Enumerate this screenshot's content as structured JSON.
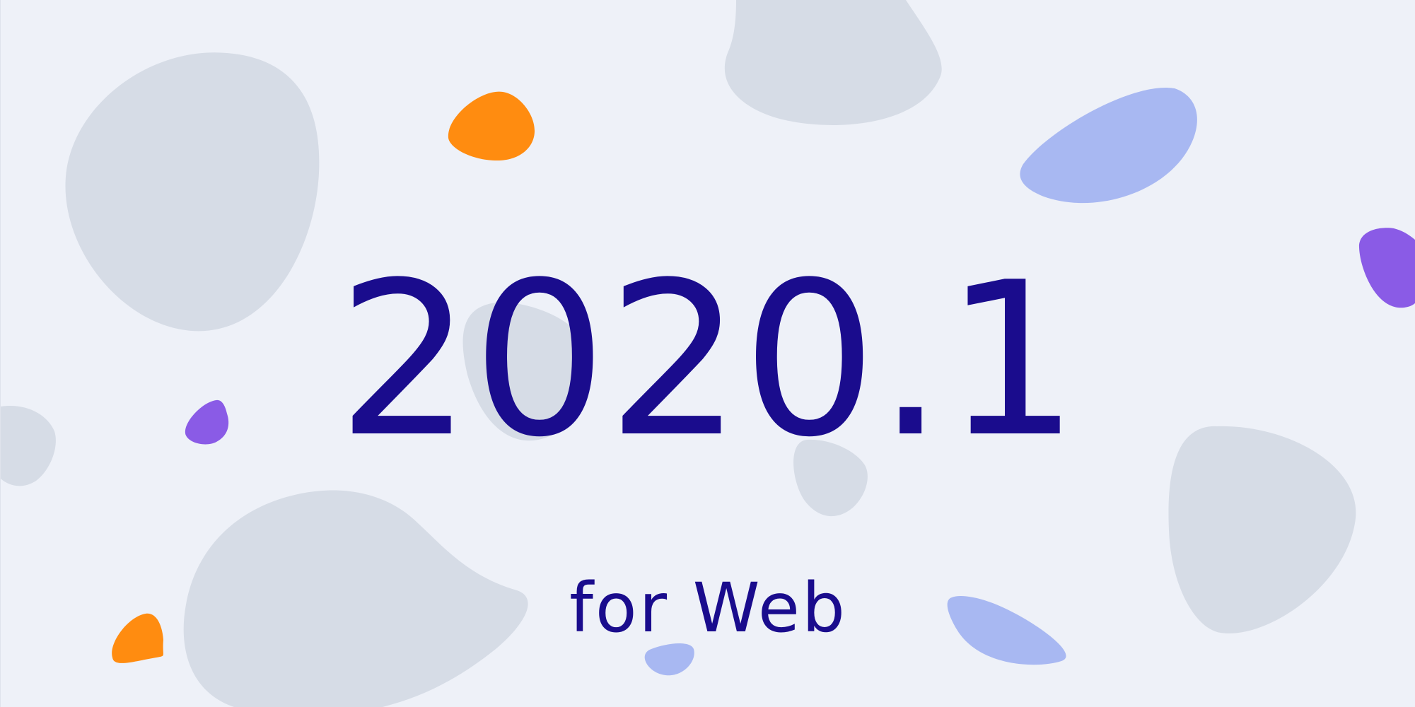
{
  "release": {
    "version": "2020.1",
    "platform": "for Web"
  },
  "colors": {
    "background": "#eef1f8",
    "text": "#1a0c8d",
    "blob_gray": "#d6dce6",
    "blob_orange": "#ff8c10",
    "blob_purple": "#8a5be6",
    "blob_blue": "#a8b8f2"
  }
}
